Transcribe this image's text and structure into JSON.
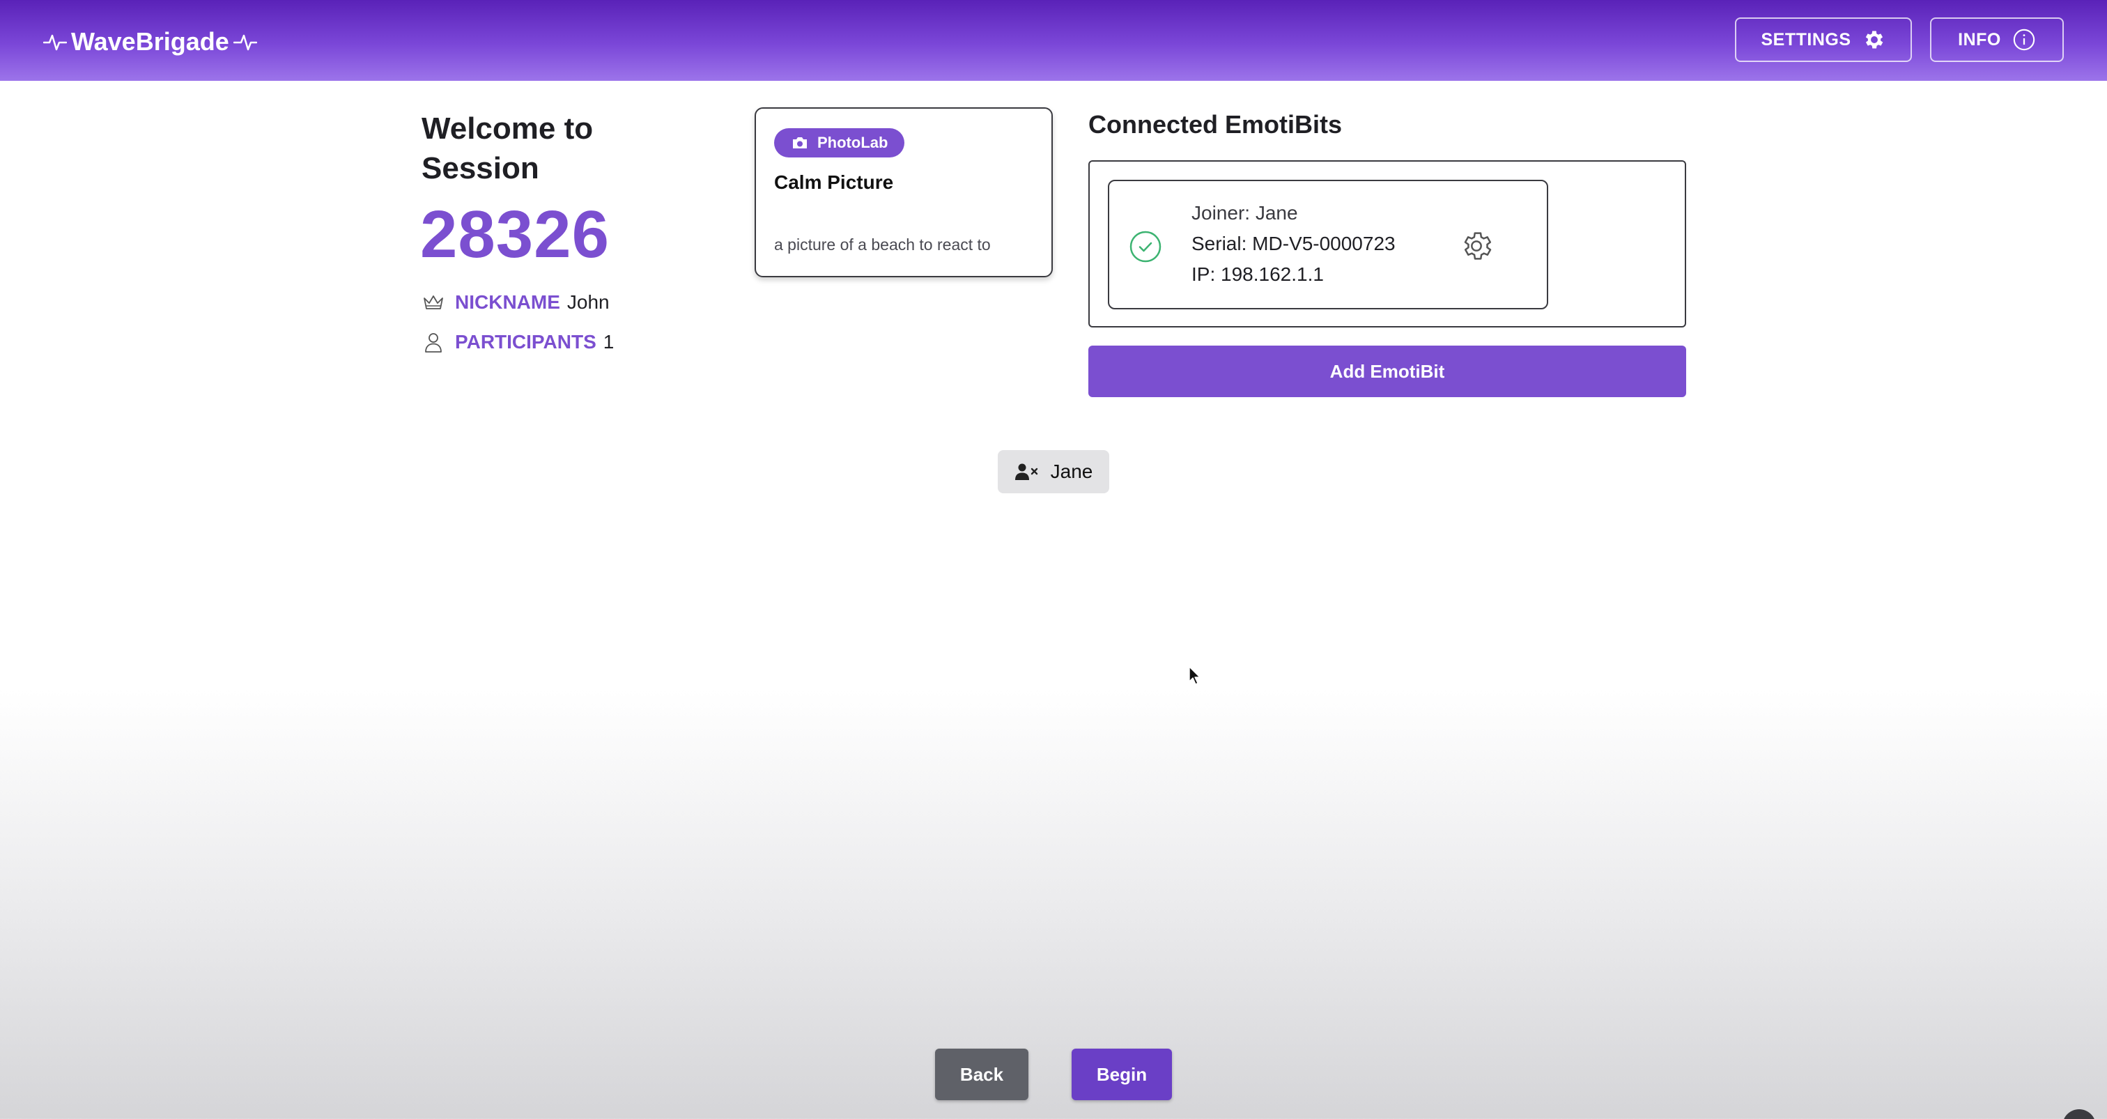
{
  "header": {
    "brand": "WaveBrigade",
    "settings_label": "SETTINGS",
    "info_label": "INFO",
    "gradient_colors": [
      "#5a22b8",
      "#9c74ea"
    ]
  },
  "session": {
    "welcome_line1": "Welcome to",
    "welcome_line2": "Session",
    "code": "28326",
    "nickname_label": "NICKNAME",
    "nickname_value": "John",
    "participants_label": "PARTICIPANTS",
    "participants_value": "1",
    "accent_color": "#7b4fd0"
  },
  "activity": {
    "tag": "PhotoLab",
    "tag_icon": "camera-icon",
    "title": "Calm Picture",
    "description": "a picture of a beach to react to"
  },
  "emotibits": {
    "title": "Connected EmotiBits",
    "devices": [
      {
        "joiner": "Joiner: Jane",
        "serial": "Serial: MD-V5-0000723",
        "ip": "IP: 198.162.1.1",
        "status_icon": "check-circle-icon",
        "status_color": "#3cb371"
      }
    ],
    "add_button_label": "Add EmotiBit"
  },
  "participant_chip": {
    "name": "Jane",
    "icon": "user-remove-icon"
  },
  "footer": {
    "back_label": "Back",
    "begin_label": "Begin"
  }
}
